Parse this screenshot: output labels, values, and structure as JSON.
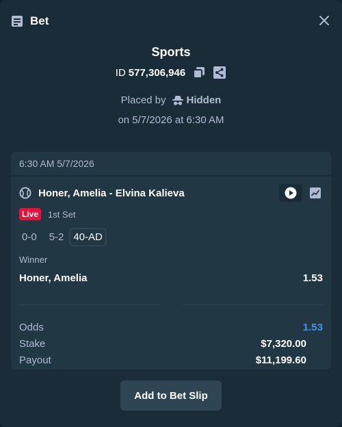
{
  "topbar": {
    "title": "Bet"
  },
  "header": {
    "sport": "Sports",
    "id_prefix": "ID",
    "id_number": "577,306,946",
    "placed_by_label": "Placed by",
    "placed_by_user": "Hidden",
    "placed_on": "on 5/7/2026 at 6:30 AM"
  },
  "card": {
    "timestamp": "6:30 AM 5/7/2026",
    "match": "Honer, Amelia - Elvina Kalieva",
    "live_badge": "Live",
    "period": "1st Set",
    "scores": [
      "0-0",
      "5-2"
    ],
    "point_score": "40-AD",
    "market": "Winner",
    "pick": "Honer, Amelia",
    "pick_odds": "1.53"
  },
  "summary": {
    "odds_label": "Odds",
    "odds_value": "1.53",
    "stake_label": "Stake",
    "stake_value": "$7,320.00",
    "payout_label": "Payout",
    "payout_value": "$11,199.60"
  },
  "actions": {
    "add_to_slip": "Add to Bet Slip"
  },
  "colors": {
    "background": "#1a2c38",
    "card": "#213743",
    "live": "#e9113c",
    "odds_accent": "#4391e7",
    "button": "#2f4553"
  },
  "icons": {
    "bet": "bet-slip-icon",
    "close": "close-icon",
    "copy": "copy-icon",
    "share": "share-icon",
    "hidden": "incognito-icon",
    "sport": "tennis-ball-icon",
    "play": "play-icon",
    "stats": "stats-chart-icon"
  }
}
